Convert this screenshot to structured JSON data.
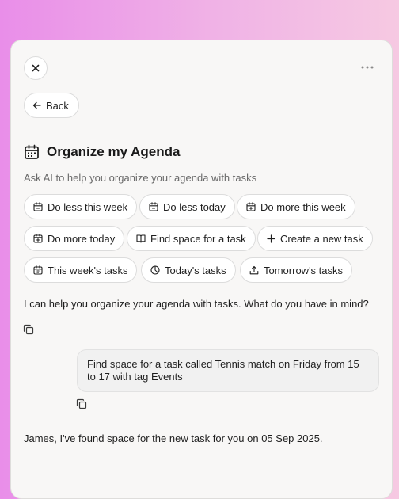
{
  "header": {
    "close_icon": "close-icon",
    "more_icon": "more-horizontal-icon"
  },
  "back": {
    "label": "Back",
    "icon": "arrow-left-icon"
  },
  "title": {
    "text": "Organize my Agenda",
    "icon": "calendar-icon"
  },
  "subtitle": "Ask AI to help you organize your agenda with tasks",
  "suggestions": [
    {
      "label": "Do less this week",
      "icon": "calendar-minus-icon"
    },
    {
      "label": "Do less today",
      "icon": "calendar-minus-icon"
    },
    {
      "label": "Do more this week",
      "icon": "calendar-plus-icon"
    },
    {
      "label": "Do more today",
      "icon": "calendar-plus-icon"
    },
    {
      "label": "Find space for a task",
      "icon": "book-open-icon"
    },
    {
      "label": "Create a new task",
      "icon": "plus-icon"
    },
    {
      "label": "This week's tasks",
      "icon": "calendar-days-icon"
    },
    {
      "label": "Today's tasks",
      "icon": "clock-pie-icon"
    },
    {
      "label": "Tomorrow's tasks",
      "icon": "upload-tray-icon"
    }
  ],
  "messages": [
    {
      "role": "assistant",
      "text": "I can help you organize your agenda with tasks. What do you have in mind?"
    },
    {
      "role": "user",
      "text": "Find space for a task called Tennis match on Friday from 15 to 17 with tag Events"
    },
    {
      "role": "assistant",
      "text": "James, I've found space for the new task for you on 05 Sep 2025."
    }
  ],
  "colors": {
    "panel_bg": "#f8f7f6",
    "pill_bg": "#ffffff",
    "border": "#dcdcdc",
    "bubble_bg": "#f1f1f1"
  }
}
